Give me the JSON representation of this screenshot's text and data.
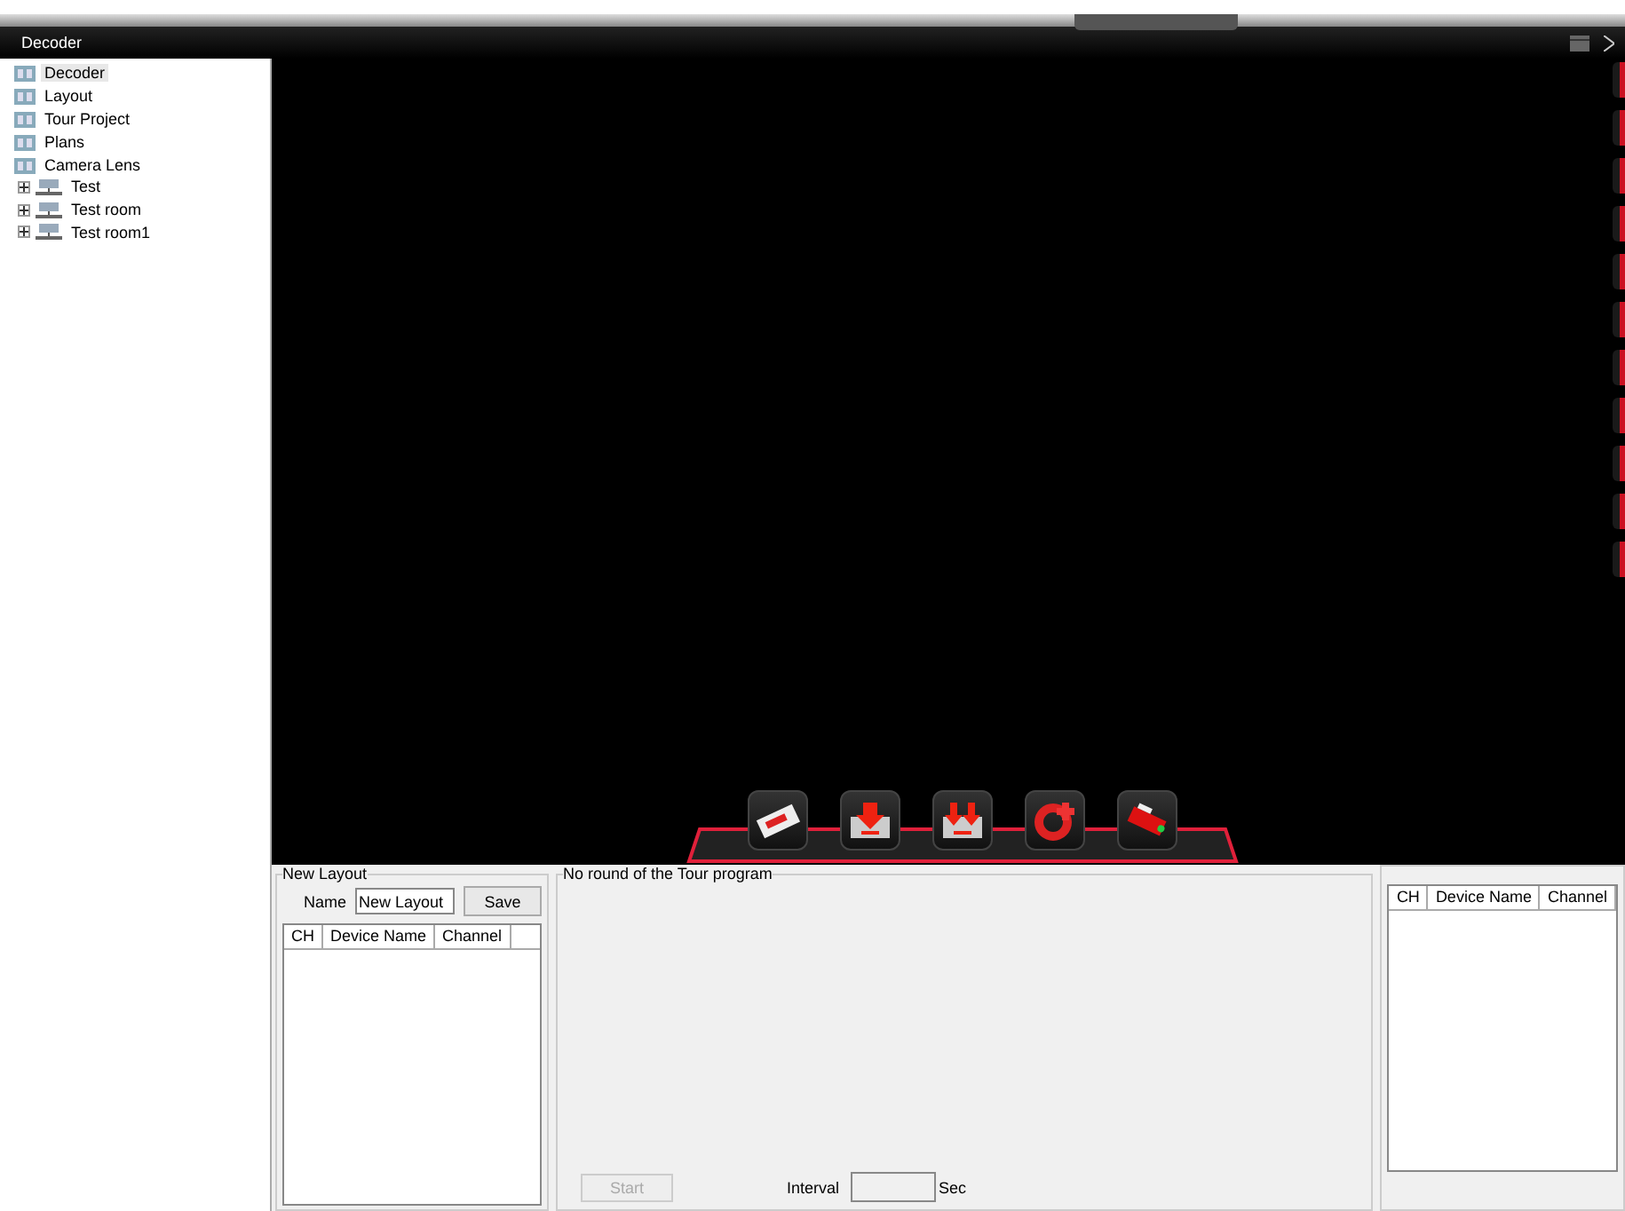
{
  "window": {
    "title": "Decoder"
  },
  "tree": [
    {
      "label": "Decoder",
      "kind": "folder",
      "selected": true
    },
    {
      "label": "Layout",
      "kind": "folder",
      "selected": false
    },
    {
      "label": "Tour Project",
      "kind": "folder",
      "selected": false
    },
    {
      "label": "Plans",
      "kind": "folder",
      "selected": false
    },
    {
      "label": "Camera Lens",
      "kind": "folder",
      "selected": false
    },
    {
      "label": "Test",
      "kind": "device",
      "selected": false,
      "expanded": false
    },
    {
      "label": "Test room",
      "kind": "device",
      "selected": false,
      "expanded": false
    },
    {
      "label": "Test room1",
      "kind": "device",
      "selected": false,
      "expanded": false
    }
  ],
  "toolbar": [
    {
      "kind": "card"
    },
    {
      "kind": "download"
    },
    {
      "kind": "download-all"
    },
    {
      "kind": "refresh"
    },
    {
      "kind": "camera"
    }
  ],
  "new_layout": {
    "title": "New Layout",
    "name_label": "Name",
    "name_value": "New Layout",
    "save": "Save",
    "columns": [
      "CH",
      "Device Name",
      "Channel"
    ]
  },
  "tour": {
    "title": "No round of the Tour program",
    "start": {
      "label": "Start",
      "disabled": true
    },
    "interval_label": "Interval",
    "interval_unit": "Sec"
  },
  "right_table": {
    "columns": [
      "CH",
      "Device Name",
      "Channel"
    ]
  }
}
